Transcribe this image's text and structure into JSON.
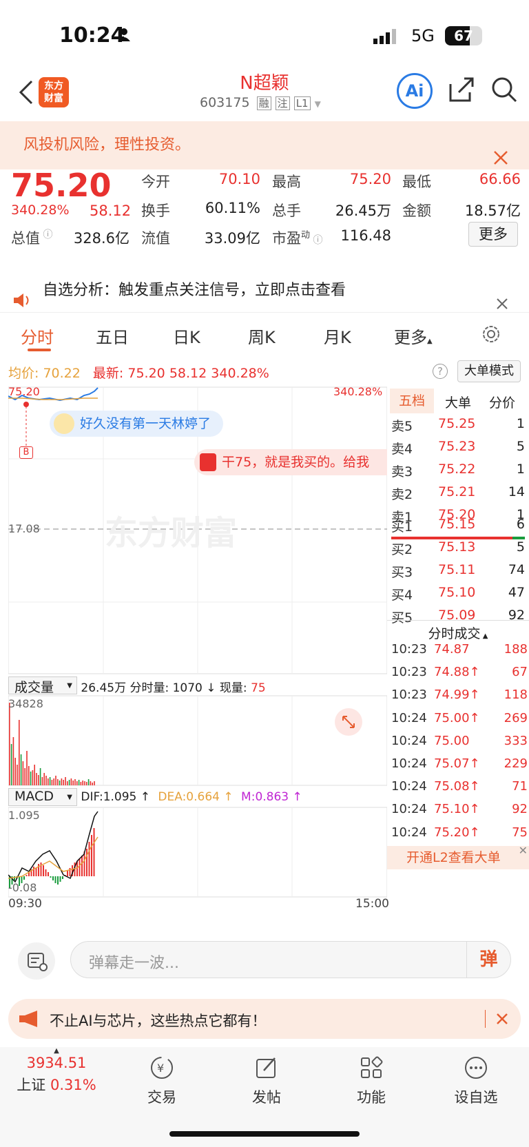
{
  "status": {
    "time": "10:24",
    "network": "5G",
    "battery": "67",
    "battery_level": 0.67
  },
  "header": {
    "title": "N超颖",
    "code": "603175",
    "tags": [
      "融",
      "注",
      "L1"
    ],
    "logo": "东方\n财富",
    "ai_label": "Ai"
  },
  "risk_banner": "风投机风险，理性投资。",
  "quote": {
    "price": "75.20",
    "pct": "340.28%",
    "change": "58.12",
    "today_open_label": "今开",
    "today_open": "70.10",
    "high_label": "最高",
    "high": "75.20",
    "low_label": "最低",
    "low": "66.66",
    "turnover_label": "换手",
    "turnover": "60.11%",
    "volume_label": "总手",
    "volume": "26.45万",
    "amount_label": "金额",
    "amount": "18.57亿",
    "mcap_label": "总值",
    "mcap": "328.6亿",
    "float_label": "流值",
    "float": "33.09亿",
    "pe_label": "市盈",
    "pe_sup": "动",
    "pe": "116.48",
    "more": "更多"
  },
  "notice": "自选分析：触发重点关注信号，立即点击查看",
  "tabs": [
    "分时",
    "五日",
    "日K",
    "周K",
    "月K",
    "更多"
  ],
  "info": {
    "avg_label": "均价:",
    "avg": "70.22",
    "latest_label": "最新:",
    "latest": "75.20",
    "change": "58.12",
    "pct": "340.28%",
    "bigmode": "大单模式"
  },
  "chart": {
    "top_price": "75.20",
    "top_pct": "340.28%",
    "base_price": "17.08",
    "watermark": "东方财富",
    "marker": "B",
    "danmu1": "好久没有第一天林婷了",
    "danmu2": "干75，就是我买的。给我",
    "vol_selector": "成交量",
    "vol_info": "26.45万 分时量: 1070 ↓ 现量:",
    "vol_now": "75",
    "vol_max": "34828",
    "macd_selector": "MACD",
    "dif": "DIF:1.095 ↑",
    "dea": "DEA:0.664 ↑",
    "m": "M:0.863 ↑",
    "macd_top": "1.095",
    "macd_bottom": "-0.08",
    "time_start": "09:30",
    "time_end": "15:00"
  },
  "book": {
    "tabs": [
      "五档",
      "大单",
      "分价"
    ],
    "asks": [
      {
        "n": "卖5",
        "p": "75.25",
        "q": "1"
      },
      {
        "n": "卖4",
        "p": "75.23",
        "q": "5"
      },
      {
        "n": "卖3",
        "p": "75.22",
        "q": "1"
      },
      {
        "n": "卖2",
        "p": "75.21",
        "q": "14"
      },
      {
        "n": "卖1",
        "p": "75.20",
        "q": "1"
      }
    ],
    "bids": [
      {
        "n": "买1",
        "p": "75.15",
        "q": "6"
      },
      {
        "n": "买2",
        "p": "75.13",
        "q": "5"
      },
      {
        "n": "买3",
        "p": "75.11",
        "q": "74"
      },
      {
        "n": "买4",
        "p": "75.10",
        "q": "47"
      },
      {
        "n": "买5",
        "p": "75.09",
        "q": "92"
      }
    ],
    "trades_title": "分时成交",
    "trades": [
      {
        "t": "10:23",
        "p": "74.87",
        "q": "188"
      },
      {
        "t": "10:23",
        "p": "74.88↑",
        "q": "67"
      },
      {
        "t": "10:23",
        "p": "74.99↑",
        "q": "118"
      },
      {
        "t": "10:24",
        "p": "75.00↑",
        "q": "269"
      },
      {
        "t": "10:24",
        "p": "75.00",
        "q": "333"
      },
      {
        "t": "10:24",
        "p": "75.07↑",
        "q": "229"
      },
      {
        "t": "10:24",
        "p": "75.08↑",
        "q": "71"
      },
      {
        "t": "10:24",
        "p": "75.10↑",
        "q": "92"
      },
      {
        "t": "10:24",
        "p": "75.20↑",
        "q": "75"
      }
    ],
    "l2": "开通L2查看大单"
  },
  "comment": {
    "placeholder": "弹幕走一波...",
    "send": "弹"
  },
  "promo": "不止AI与芯片，这些热点它都有！",
  "nav": {
    "index_value": "3934.51",
    "index_name": "上证",
    "index_pct": "0.31%",
    "items": [
      "交易",
      "发帖",
      "功能",
      "设自选"
    ]
  },
  "colors": {
    "accent": "#e65c2f",
    "up": "#e8312f",
    "down": "#1a9c3e",
    "blue": "#2a7be4"
  }
}
